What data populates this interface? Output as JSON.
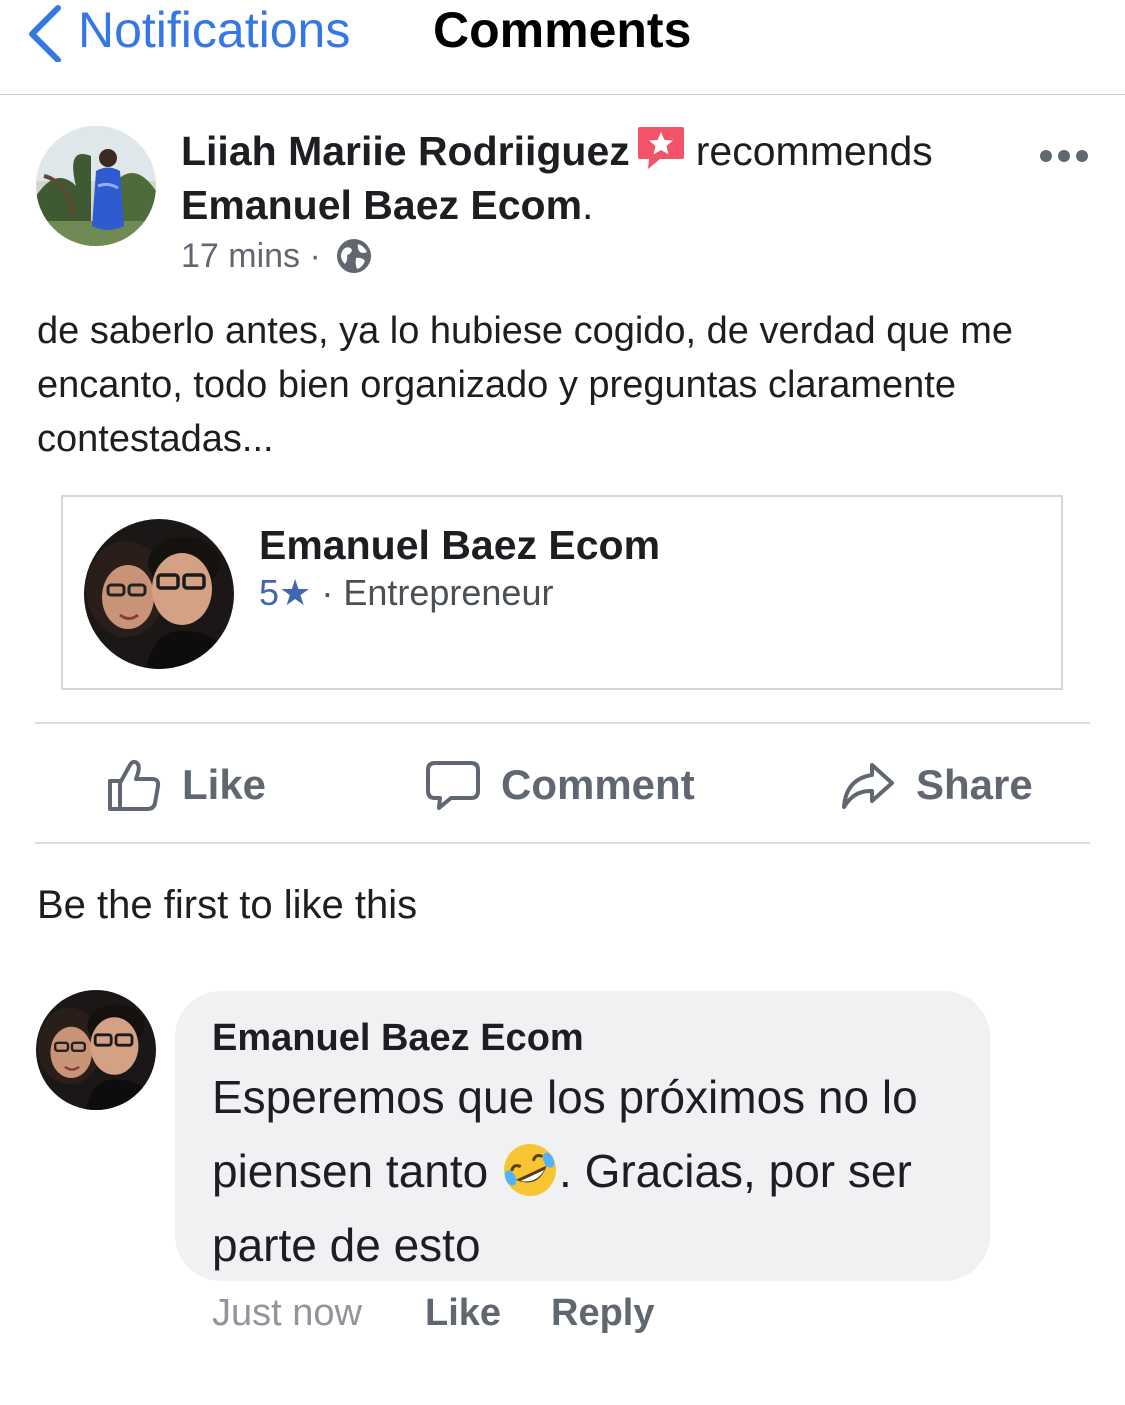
{
  "header": {
    "back_label": "Notifications",
    "title": "Comments",
    "accent_color": "#3578e5"
  },
  "post": {
    "author": "Liiah Mariie Rodriiguez",
    "verb": "recommends",
    "page_name": "Emanuel Baez Ecom",
    "page_name_suffix": ".",
    "time": "17 mins",
    "separator": "·",
    "privacy_icon": "globe-icon",
    "text": "de saberlo antes, ya lo hubiese cogido, de verdad que me encanto, todo bien organizado y preguntas claramente contestadas..."
  },
  "card": {
    "title": "Emanuel Baez Ecom",
    "rating": "5★",
    "separator": "·",
    "category": "Entrepreneur",
    "rating_color": "#4267b2"
  },
  "actions": {
    "like": "Like",
    "comment": "Comment",
    "share": "Share"
  },
  "likes_summary": "Be the first to like this",
  "comment": {
    "author": "Emanuel Baez Ecom",
    "text_before_emoji": "Esperemos que los próximos no lo piensen tanto",
    "emoji": "rolling-on-floor-laughing",
    "text_after_emoji": ". Gracias, por ser parte de esto",
    "time": "Just now",
    "like": "Like",
    "reply": "Reply"
  }
}
